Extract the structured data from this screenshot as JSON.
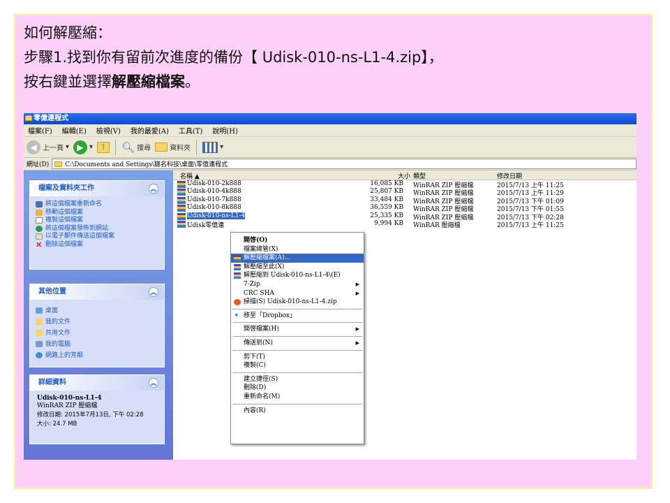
{
  "instructions": {
    "line1": "如何解壓縮：",
    "line2": "步驟1.找到你有留前次進度的備份【 Udisk-010-ns-L1-4.zip】，",
    "line3_prefix": "按右鍵並選擇",
    "line3_bold": "解壓縮檔案",
    "line3_suffix": "。"
  },
  "window": {
    "title": "零億連程式",
    "menu": [
      "檔案(F)",
      "編輯(E)",
      "檢視(V)",
      "我的最愛(A)",
      "工具(T)",
      "說明(H)"
    ],
    "toolbar": {
      "back": "上一頁",
      "search": "搜尋",
      "folders": "資料夾"
    },
    "address": {
      "label": "網址(D)",
      "path": "C:\\Documents and Settings\\聰名科技\\桌面\\零億連程式"
    }
  },
  "sidebar": {
    "tasks": {
      "title": "檔案及資料夾工作",
      "items": [
        "將這個檔案重新命名",
        "移動這個檔案",
        "複製這個檔案",
        "將這個檔案發佈到網站",
        "以電子郵件傳送這個檔案",
        "刪除這個檔案"
      ]
    },
    "places": {
      "title": "其他位置",
      "items": [
        "桌面",
        "我的文件",
        "共用文件",
        "我的電腦",
        "網路上的芳鄰"
      ]
    },
    "details": {
      "title": "詳細資料",
      "name": "Udisk-010-ns-L1-4",
      "type": "WinRAR ZIP 壓縮檔",
      "modified": "修改日期: 2015年7月13日, 下午 02:28",
      "size": "大小: 24.7 MB"
    }
  },
  "columns": {
    "name": "名稱 ▲",
    "size": "大小",
    "type": "類型",
    "date": "修改日期"
  },
  "files": [
    {
      "name": "Udisk-010-2k888",
      "size": "16,085 KB",
      "type": "WinRAR ZIP 壓縮檔",
      "date": "2015/7/13 上午 11:25"
    },
    {
      "name": "Udisk-010-4k888",
      "size": "25,807 KB",
      "type": "WinRAR ZIP 壓縮檔",
      "date": "2015/7/13 上午 11:29"
    },
    {
      "name": "Udisk-010-7k888",
      "size": "33,484 KB",
      "type": "WinRAR ZIP 壓縮檔",
      "date": "2015/7/13 下午 01:09"
    },
    {
      "name": "Udisk-010-8k888",
      "size": "36,559 KB",
      "type": "WinRAR ZIP 壓縮檔",
      "date": "2015/7/13 下午 01:55"
    },
    {
      "name": "Udisk-010-ns-L1-4",
      "size": "25,335 KB",
      "type": "WinRAR ZIP 壓縮檔",
      "date": "2015/7/13 下午 02:28"
    },
    {
      "name": "Udisk零億連",
      "size": "9,994 KB",
      "type": "WinRAR 壓縮檔",
      "date": "2015/7/13 上午 11:25"
    }
  ],
  "context_menu": {
    "open": "開啓(O)",
    "browse": "檔案總管(X)",
    "extract_files": "解壓縮檔案(A)...",
    "extract_here": "解壓縮至此(X)",
    "extract_to": "解壓縮到 Udisk-010-ns-L1-4\\(E)",
    "zip7": "7-Zip",
    "crc": "CRC SHA",
    "scan": "掃描(S) Udisk-010-ns-L1-4.zip",
    "dropbox": "移至「Dropbox」",
    "open_with": "開啓檔案(H)",
    "send_to": "傳送到(N)",
    "cut": "剪下(T)",
    "copy": "複製(C)",
    "shortcut": "建立捷徑(S)",
    "delete": "刪除(D)",
    "rename": "重新命名(M)",
    "properties": "內容(R)"
  }
}
